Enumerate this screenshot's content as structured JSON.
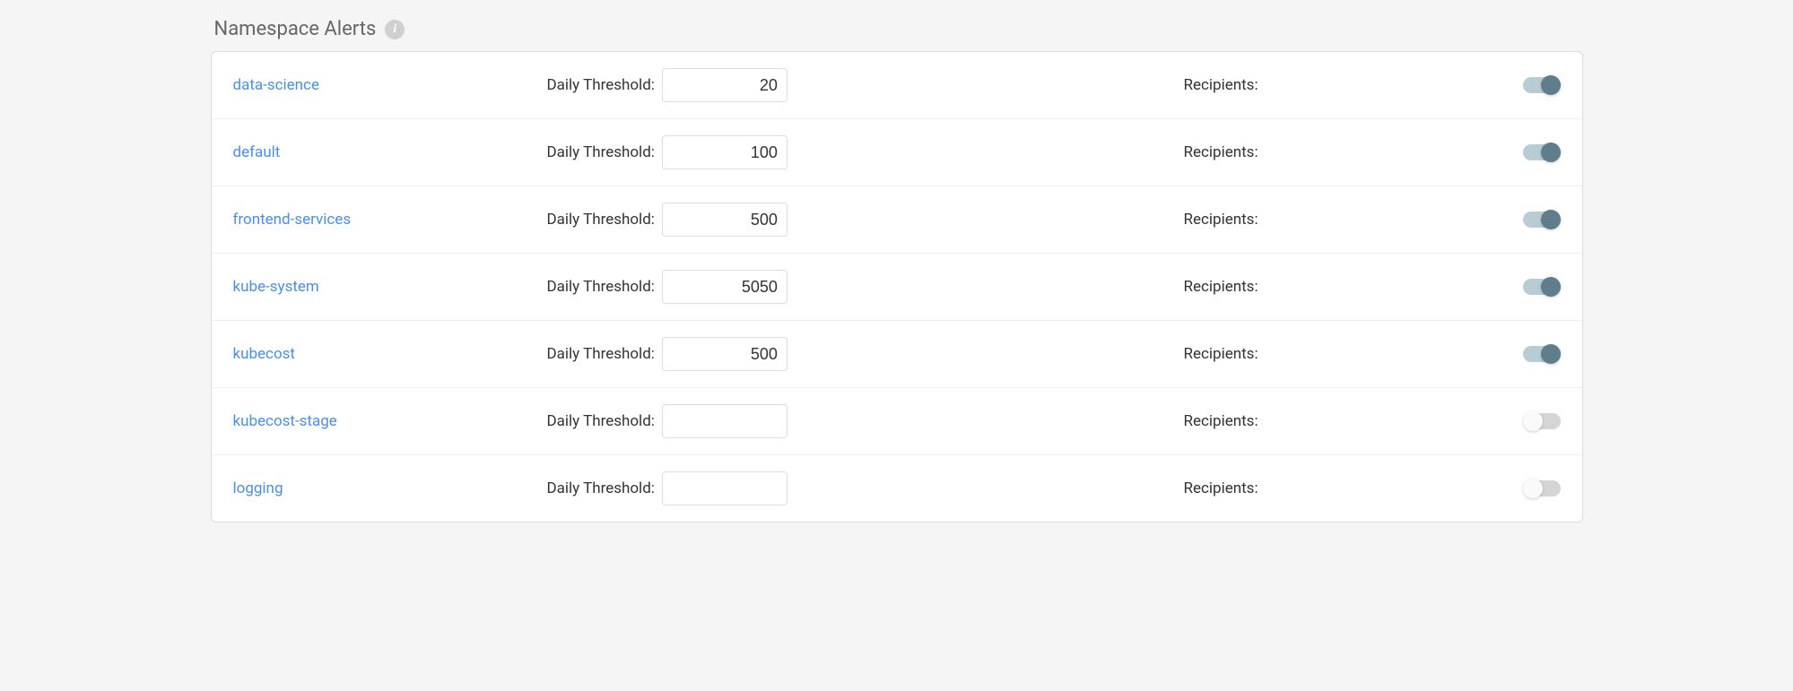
{
  "panel": {
    "title": "Namespace Alerts",
    "info_tooltip": "i"
  },
  "labels": {
    "daily_threshold": "Daily Threshold:",
    "recipients": "Recipients:"
  },
  "alerts": [
    {
      "namespace": "data-science",
      "threshold": "20",
      "recipients": "",
      "enabled": true
    },
    {
      "namespace": "default",
      "threshold": "100",
      "recipients": "",
      "enabled": true
    },
    {
      "namespace": "frontend-services",
      "threshold": "500",
      "recipients": "",
      "enabled": true
    },
    {
      "namespace": "kube-system",
      "threshold": "5050",
      "recipients": "",
      "enabled": true
    },
    {
      "namespace": "kubecost",
      "threshold": "500",
      "recipients": "",
      "enabled": true
    },
    {
      "namespace": "kubecost-stage",
      "threshold": "",
      "recipients": "",
      "enabled": false
    },
    {
      "namespace": "logging",
      "threshold": "",
      "recipients": "",
      "enabled": false
    }
  ]
}
